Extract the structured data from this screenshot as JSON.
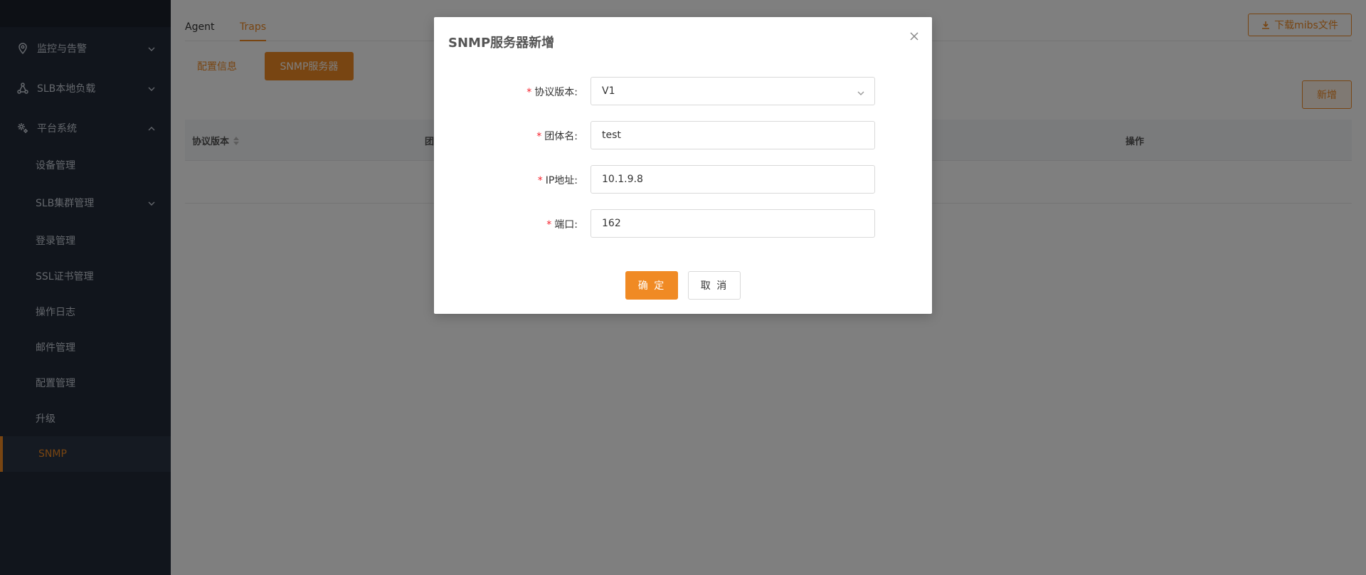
{
  "sidebar": {
    "items": [
      {
        "label": "监控与告警",
        "icon": "location-pin-icon",
        "expanded": false
      },
      {
        "label": "SLB本地负载",
        "icon": "network-nodes-icon",
        "expanded": false
      },
      {
        "label": "平台系统",
        "icon": "gear-icon",
        "expanded": true
      }
    ],
    "sub_items": [
      {
        "label": "设备管理"
      },
      {
        "label": "SLB集群管理",
        "has_children": true
      },
      {
        "label": "登录管理"
      },
      {
        "label": "SSL证书管理"
      },
      {
        "label": "操作日志"
      },
      {
        "label": "邮件管理"
      },
      {
        "label": "配置管理"
      },
      {
        "label": "升级"
      },
      {
        "label": "SNMP",
        "active": true
      }
    ]
  },
  "main": {
    "tabs": [
      {
        "label": "Agent"
      },
      {
        "label": "Traps",
        "active": true
      }
    ],
    "download_label": "下载mibs文件",
    "subtabs": [
      {
        "label": "配置信息"
      },
      {
        "label": "SNMP服务器",
        "active": true
      }
    ],
    "add_label": "新增",
    "table": {
      "columns": [
        "协议版本",
        "团",
        "操作"
      ]
    }
  },
  "modal": {
    "title": "SNMP服务器新增",
    "fields": [
      {
        "label": "协议版本:",
        "value": "V1",
        "type": "select"
      },
      {
        "label": "团体名:",
        "value": "test",
        "type": "text"
      },
      {
        "label": "IP地址:",
        "value": "10.1.9.8",
        "type": "text"
      },
      {
        "label": "端口:",
        "value": "162",
        "type": "text"
      }
    ],
    "required_mark": "*",
    "ok_label": "确 定",
    "cancel_label": "取 消"
  },
  "colors": {
    "accent": "#f08a24",
    "sidebar_bg": "#222b39",
    "required": "#f5222d"
  }
}
